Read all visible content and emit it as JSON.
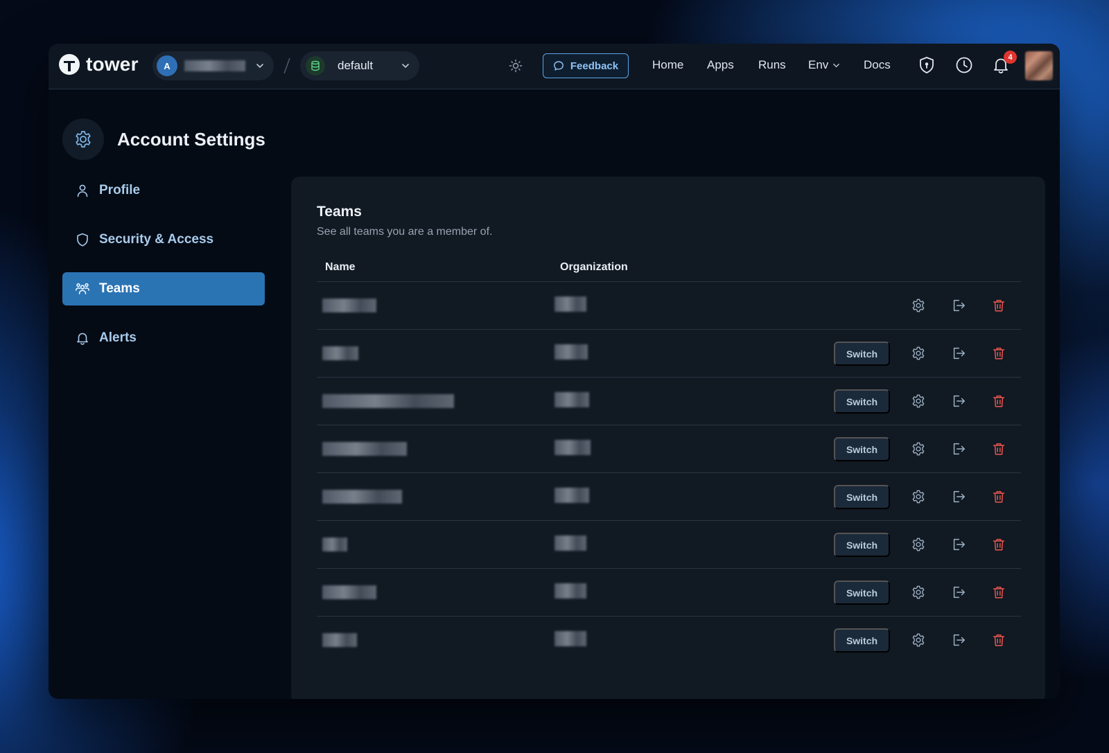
{
  "app": {
    "logo_text": "tower"
  },
  "topbar": {
    "org_avatar_letter": "A",
    "environment": "default",
    "feedback_label": "Feedback",
    "nav": [
      {
        "label": "Home"
      },
      {
        "label": "Apps"
      },
      {
        "label": "Runs"
      },
      {
        "label": "Env"
      },
      {
        "label": "Docs"
      }
    ],
    "notification_count": "4"
  },
  "sidebar": {
    "title": "Account Settings",
    "items": [
      {
        "label": "Profile",
        "icon": "user-icon"
      },
      {
        "label": "Security & Access",
        "icon": "shield-icon"
      },
      {
        "label": "Teams",
        "icon": "users-icon",
        "active": true
      },
      {
        "label": "Alerts",
        "icon": "bell-icon"
      }
    ]
  },
  "teams": {
    "title": "Teams",
    "subtitle": "See all teams you are a member of.",
    "columns": {
      "name": "Name",
      "organization": "Organization"
    },
    "switch_label": "Switch",
    "rows": [
      {
        "has_switch": false
      },
      {
        "has_switch": true
      },
      {
        "has_switch": true
      },
      {
        "has_switch": true
      },
      {
        "has_switch": true
      },
      {
        "has_switch": true
      },
      {
        "has_switch": true
      },
      {
        "has_switch": true
      }
    ]
  },
  "colors": {
    "accent": "#2b74b4",
    "danger": "#e0524c",
    "feedback": "#5fa3e6"
  }
}
